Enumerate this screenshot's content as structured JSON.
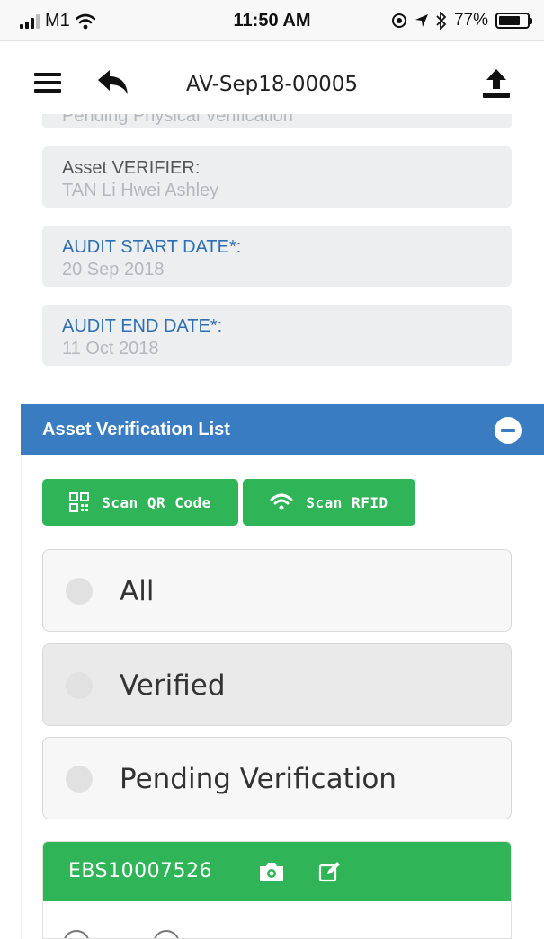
{
  "status_bar": {
    "carrier": "M1",
    "time": "11:50 AM",
    "battery_percent": "77%",
    "battery_level": 0.77,
    "icons": [
      "signal-icon",
      "wifi-icon",
      "location-lock-icon",
      "location-arrow-icon",
      "bluetooth-icon",
      "battery-icon"
    ]
  },
  "navbar": {
    "title": "AV-Sep18-00005",
    "icons": [
      "menu-icon",
      "back-icon",
      "upload-icon"
    ]
  },
  "fields": {
    "status_value": "Pending Physical Verification",
    "verifier_label": "Asset VERIFIER:",
    "verifier_value": "TAN Li Hwei Ashley",
    "start_label": "AUDIT START DATE*:",
    "start_value": "20 Sep 2018",
    "end_label": "AUDIT END DATE*:",
    "end_value": "11 Oct 2018"
  },
  "panel": {
    "title": "Asset Verification List",
    "scan_qr_label": "Scan QR Code",
    "scan_rfid_label": "Scan RFID",
    "filters": [
      {
        "label": "All",
        "selected": false
      },
      {
        "label": "Verified",
        "selected": true
      },
      {
        "label": "Pending Verification",
        "selected": false
      }
    ]
  },
  "asset": {
    "id": "EBS10007526",
    "icons": [
      "camera-icon",
      "edit-icon"
    ]
  },
  "colors": {
    "accent_blue": "#3a7cc1",
    "label_blue": "#2e6fb2",
    "green": "#2fb457",
    "field_bg": "#eceeef"
  }
}
